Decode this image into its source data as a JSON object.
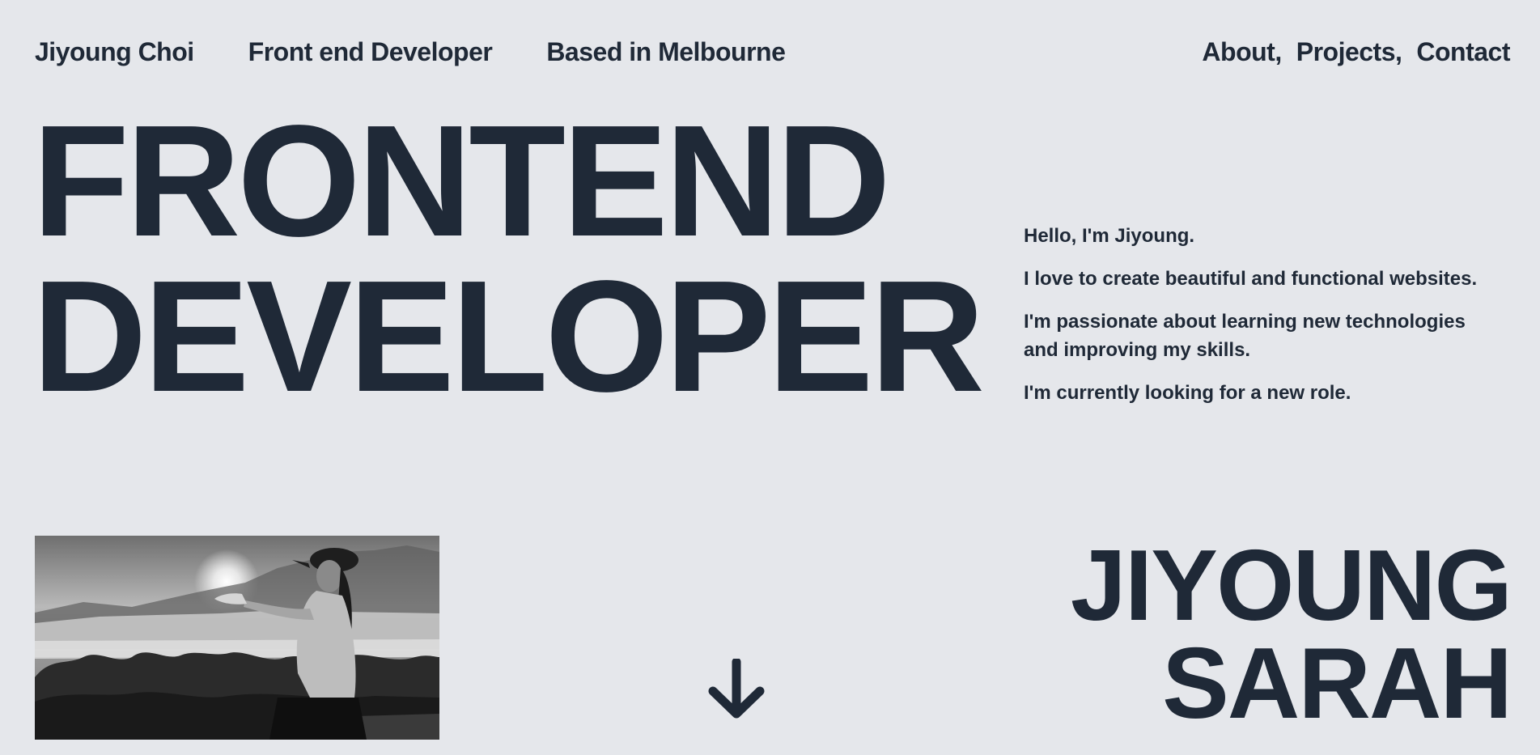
{
  "header": {
    "name": "Jiyoung Choi",
    "role": "Front end Developer",
    "location": "Based in Melbourne",
    "nav": [
      "About,",
      "Projects,",
      "Contact"
    ]
  },
  "hero": {
    "line1": "FRONTEND",
    "line2": "DEVELOPER"
  },
  "intro": [
    "Hello, I'm Jiyoung.",
    "I love to create beautiful and functional websites.",
    "I'm passionate about learning new technologies and improving my skills.",
    "I'm currently looking for a new role."
  ],
  "name_block": {
    "line1": "JIYOUNG",
    "line2": "SARAH"
  },
  "icons": {
    "scroll": "arrow-down-icon"
  },
  "colors": {
    "background": "#e5e7eb",
    "text": "#1f2937"
  }
}
